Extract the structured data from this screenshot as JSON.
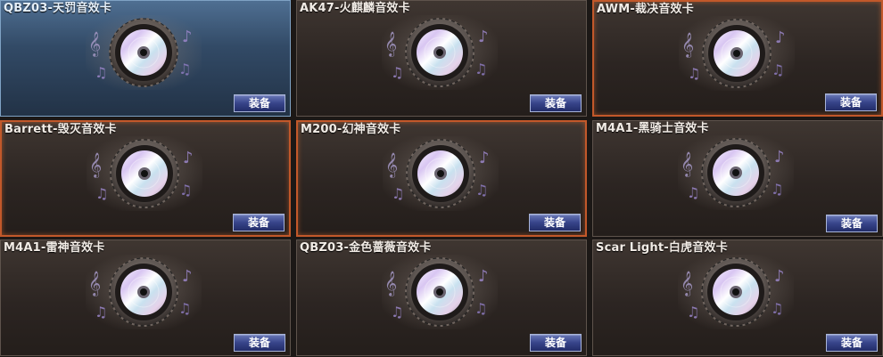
{
  "cards": [
    {
      "title": "QBZ03-天罚音效卡",
      "button": "装备",
      "state": "selected"
    },
    {
      "title": "AK47-火麒麟音效卡",
      "button": "装备",
      "state": "normal"
    },
    {
      "title": "AWM-裁决音效卡",
      "button": "装备",
      "state": "highlight"
    },
    {
      "title": "Barrett-毁灭音效卡",
      "button": "装备",
      "state": "highlight"
    },
    {
      "title": "M200-幻神音效卡",
      "button": "装备",
      "state": "highlight"
    },
    {
      "title": "M4A1-黑骑士音效卡",
      "button": "装备",
      "state": "normal"
    },
    {
      "title": "M4A1-雷神音效卡",
      "button": "装备",
      "state": "normal"
    },
    {
      "title": "QBZ03-金色蔷薇音效卡",
      "button": "装备",
      "state": "normal"
    },
    {
      "title": "Scar Light-白虎音效卡",
      "button": "装备",
      "state": "normal"
    }
  ],
  "icons": {
    "card_art": "music-cd-speaker-icon"
  },
  "colors": {
    "button_bg": "#37448a",
    "highlight_border": "#c2582a",
    "selected_bg": "#4f6f92"
  }
}
